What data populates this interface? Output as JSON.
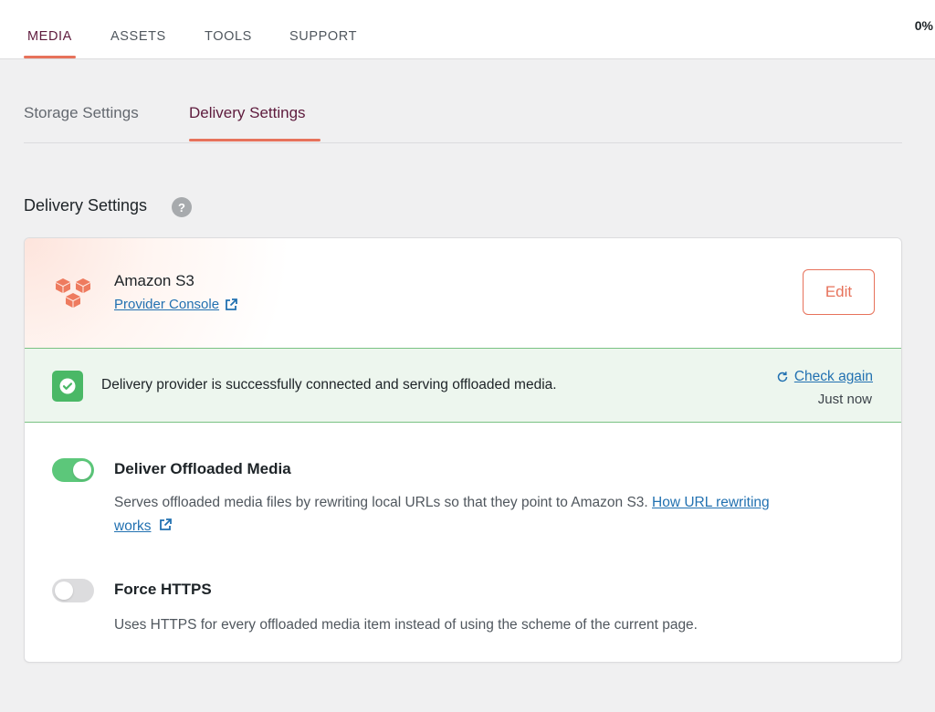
{
  "topnav": {
    "tabs": [
      {
        "label": "MEDIA",
        "active": true
      },
      {
        "label": "ASSETS",
        "active": false
      },
      {
        "label": "TOOLS",
        "active": false
      },
      {
        "label": "SUPPORT",
        "active": false
      }
    ],
    "progress": "0%"
  },
  "subtabs": {
    "storage": "Storage Settings",
    "delivery": "Delivery Settings"
  },
  "section": {
    "title": "Delivery Settings",
    "help": "?"
  },
  "provider": {
    "name": "Amazon S3",
    "console_link": "Provider Console",
    "edit_label": "Edit",
    "icon": "aws-s3-icon"
  },
  "status": {
    "message": "Delivery provider is successfully connected and serving offloaded media.",
    "check_again": "Check again",
    "last_checked": "Just now"
  },
  "settings": {
    "deliver": {
      "title": "Deliver Offloaded Media",
      "enabled": true,
      "desc": "Serves offloaded media files by rewriting local URLs so that they point to Amazon S3.",
      "link_part1": "How URL rewriting",
      "link_part2": "works"
    },
    "https": {
      "title": "Force HTTPS",
      "enabled": false,
      "desc": "Uses HTTPS for every offloaded media item instead of using the scheme of the current page."
    }
  },
  "colors": {
    "accent": "#e7725b",
    "active_text": "#5e1b3d",
    "link": "#2271b1",
    "success": "#4ab866"
  }
}
